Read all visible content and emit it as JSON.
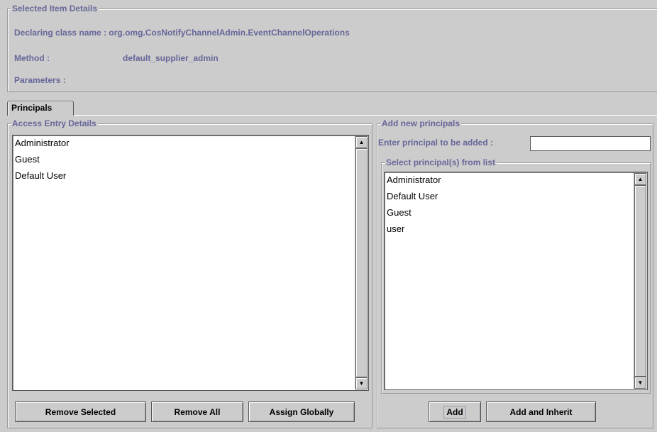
{
  "selected_item": {
    "legend": "Selected Item Details",
    "declaring_label": "Declaring class name :",
    "declaring_value": "org.omg.CosNotifyChannelAdmin.EventChannelOperations",
    "method_label": "Method :",
    "method_value": "default_supplier_admin",
    "parameters_label": "Parameters :"
  },
  "tabs": [
    {
      "label": "Principals",
      "selected": true
    }
  ],
  "access_entry": {
    "legend": "Access Entry Details",
    "items": [
      "Administrator",
      "Guest",
      "Default User"
    ],
    "buttons": {
      "remove_selected": "Remove Selected",
      "remove_all": "Remove All",
      "assign_globally": "Assign Globally"
    }
  },
  "add_principals": {
    "legend": "Add new principals",
    "enter_label": "Enter principal to be added :",
    "enter_value": "",
    "select_legend": "Select principal(s) from list",
    "items": [
      "Administrator",
      "Default User",
      "Guest",
      "user"
    ],
    "buttons": {
      "add": "Add",
      "add_inherit": "Add and Inherit"
    }
  },
  "icons": {
    "scroll_up": "▲",
    "scroll_down": "▼"
  },
  "colors": {
    "background": "#cccccc",
    "label_blue": "#66669a"
  }
}
